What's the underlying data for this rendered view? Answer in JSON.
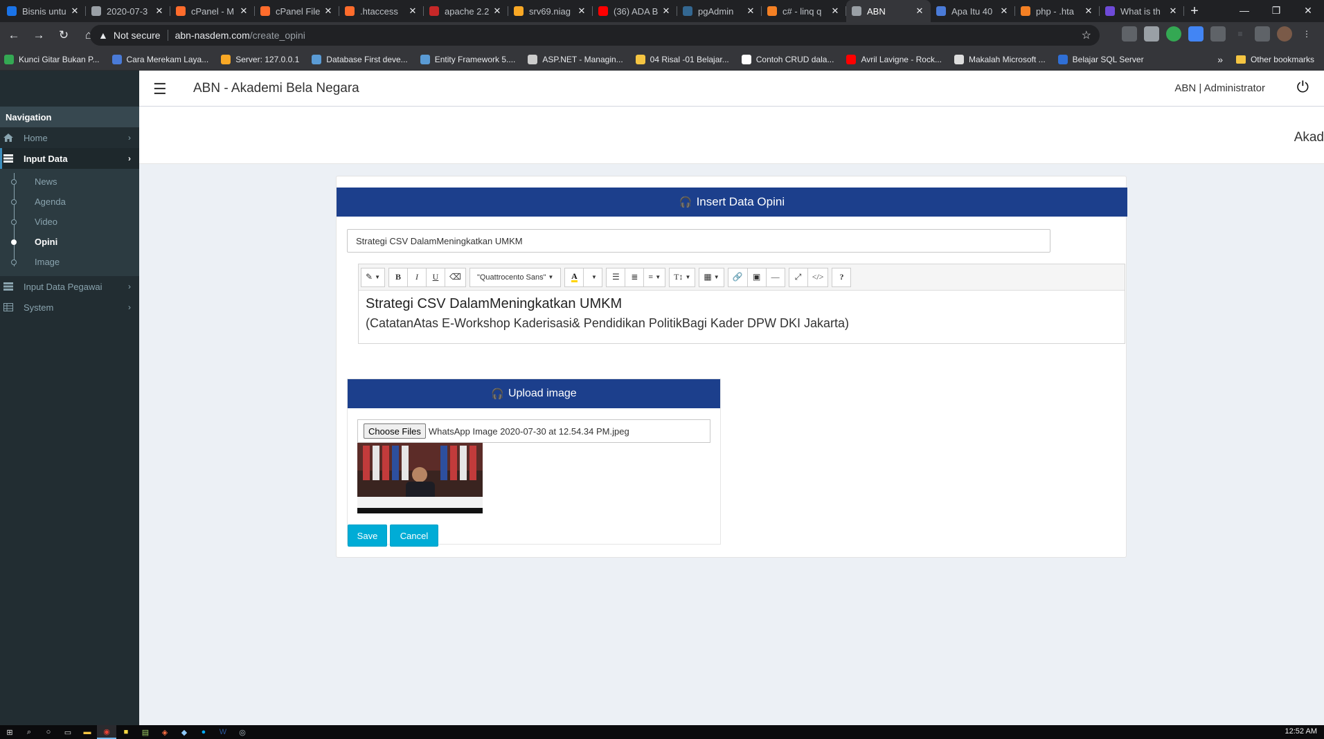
{
  "browser": {
    "tabs": [
      {
        "title": "Bisnis untu",
        "icon": "wave-icon",
        "color": "#1a73e8"
      },
      {
        "title": "2020-07-3",
        "icon": "globe-icon",
        "color": "#9aa0a6"
      },
      {
        "title": "cPanel - M",
        "icon": "cpanel-icon",
        "color": "#ff6c2c"
      },
      {
        "title": "cPanel File",
        "icon": "cpanel-icon",
        "color": "#ff6c2c"
      },
      {
        "title": ".htaccess",
        "icon": "cpanel-icon",
        "color": "#ff6c2c"
      },
      {
        "title": "apache 2.2",
        "icon": "document-icon",
        "color": "#c62828"
      },
      {
        "title": "srv69.niag",
        "icon": "warning-icon",
        "color": "#f9a825"
      },
      {
        "title": "(36) ADA B",
        "icon": "youtube-icon",
        "color": "#ff0000"
      },
      {
        "title": "pgAdmin",
        "icon": "pgadmin-icon",
        "color": "#336791"
      },
      {
        "title": "c# - linq q",
        "icon": "stackoverflow-icon",
        "color": "#f48024"
      },
      {
        "title": "ABN",
        "icon": "globe-icon",
        "color": "#9aa0a6"
      },
      {
        "title": "Apa Itu 40",
        "icon": "feather-icon",
        "color": "#4a7bd8"
      },
      {
        "title": "php - .hta",
        "icon": "stackoverflow-icon",
        "color": "#f48024"
      },
      {
        "title": "What is th",
        "icon": "h-icon",
        "color": "#6e4ad8"
      }
    ],
    "url_security": "Not secure",
    "url_domain": "abn-nasdem.com",
    "url_path": "/create_opini",
    "bookmarks": [
      {
        "label": "Kunci Gitar Bukan P...",
        "color": "#34a853"
      },
      {
        "label": "Cara Merekam Laya...",
        "color": "#4a7bd8"
      },
      {
        "label": "Server: 127.0.0.1",
        "color": "#f9a825"
      },
      {
        "label": "Database First deve...",
        "color": "#5a9bd5"
      },
      {
        "label": "Entity Framework 5....",
        "color": "#5a9bd5"
      },
      {
        "label": "ASP.NET - Managin...",
        "color": "#cccccc"
      },
      {
        "label": "04 Risal -01 Belajar...",
        "color": "#f5c542"
      },
      {
        "label": "Contoh CRUD dala...",
        "color": "#ffffff"
      },
      {
        "label": "Avril Lavigne - Rock...",
        "color": "#ff0000"
      },
      {
        "label": "Makalah Microsoft ...",
        "color": "#dddddd"
      },
      {
        "label": "Belajar SQL Server",
        "color": "#2f6fd6"
      }
    ],
    "bookmarks_more": "»",
    "other_bookmarks": "Other bookmarks"
  },
  "app": {
    "title": "ABN - Akademi Bela Negara",
    "user": "ABN | Administrator",
    "marquee": "Akad"
  },
  "sidebar": {
    "heading": "Navigation",
    "items": [
      {
        "label": "Home",
        "icon": "home-icon"
      },
      {
        "label": "Input Data",
        "icon": "list-icon"
      },
      {
        "label": "Input Data Pegawai",
        "icon": "list-icon"
      },
      {
        "label": "System",
        "icon": "table-icon"
      }
    ],
    "subitems": [
      "News",
      "Agenda",
      "Video",
      "Opini",
      "Image"
    ]
  },
  "form": {
    "header": "Insert Data Opini",
    "title_value": "Strategi CSV DalamMeningkatkan UMKM",
    "editor": {
      "font": "\"Quattrocento Sans\"",
      "content_title": "Strategi CSV DalamMeningkatkan UMKM",
      "content_subtitle": "(CatatanAtas E-Workshop Kaderisasi& Pendidikan PolitikBagi Kader DPW DKI Jakarta)"
    },
    "upload": {
      "header": "Upload image",
      "choose_label": "Choose Files",
      "file_name": "WhatsApp Image 2020-07-30 at 12.54.34 PM.jpeg"
    },
    "save_label": "Save",
    "cancel_label": "Cancel"
  },
  "taskbar": {
    "time": "12:52 AM"
  },
  "colors": {
    "brand_blue": "#1c3f8c",
    "button_cyan": "#00acd6",
    "sidebar_bg": "#222d32"
  }
}
